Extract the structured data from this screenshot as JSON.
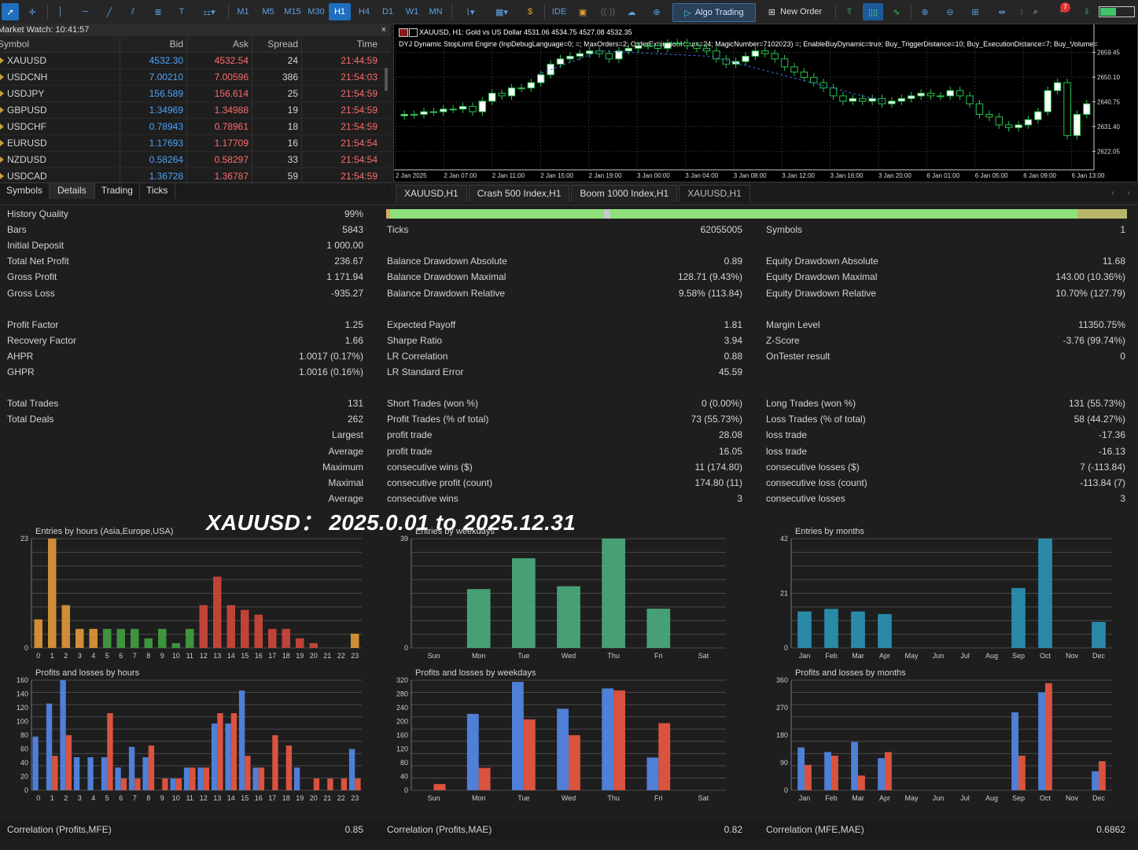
{
  "toolbar": {
    "timeframes": [
      "M1",
      "M5",
      "M15",
      "M30",
      "H1",
      "H4",
      "D1",
      "W1",
      "MN"
    ],
    "active_tf": "H1",
    "ide": "IDE",
    "algo": "Algo Trading",
    "new_order": "New Order",
    "notif_count": "7"
  },
  "market_watch": {
    "title": "Market Watch: 10:41:57",
    "close": "×",
    "headers": {
      "symbol": "Symbol",
      "bid": "Bid",
      "ask": "Ask",
      "spread": "Spread",
      "time": "Time"
    },
    "rows": [
      {
        "symbol": "XAUUSD",
        "bid": "4532.30",
        "ask": "4532.54",
        "spread": "24",
        "time": "21:44:59"
      },
      {
        "symbol": "USDCNH",
        "bid": "7.00210",
        "ask": "7.00596",
        "spread": "386",
        "time": "21:54:03"
      },
      {
        "symbol": "USDJPY",
        "bid": "156.589",
        "ask": "156.614",
        "spread": "25",
        "time": "21:54:59"
      },
      {
        "symbol": "GBPUSD",
        "bid": "1.34969",
        "ask": "1.34988",
        "spread": "19",
        "time": "21:54:59"
      },
      {
        "symbol": "USDCHF",
        "bid": "0.78943",
        "ask": "0.78961",
        "spread": "18",
        "time": "21:54:59"
      },
      {
        "symbol": "EURUSD",
        "bid": "1.17693",
        "ask": "1.17709",
        "spread": "16",
        "time": "21:54:54"
      },
      {
        "symbol": "NZDUSD",
        "bid": "0.58264",
        "ask": "0.58297",
        "spread": "33",
        "time": "21:54:54"
      },
      {
        "symbol": "USDCAD",
        "bid": "1.36728",
        "ask": "1.36787",
        "spread": "59",
        "time": "21:54:59"
      }
    ],
    "tabs": [
      "Symbols",
      "Details",
      "Trading",
      "Ticks"
    ]
  },
  "chart": {
    "info1": "XAUUSD, H1:  Gold vs US Dollar  4531.06  4534.75  4527.08  4532.35",
    "info2": "DYJ Dynamic StopLimit Engine (InpDebugLanguage=0; =; MaxOrders=2; OrderExpirationHours=24; MagicNumber=7102023) =; EnableBuyDynamic=true; Buy_TriggerDistance=10; Buy_ExecutionDistance=7; Buy_Volume=",
    "price_ticks": [
      "2659.45",
      "2650.10",
      "2640.75",
      "2631.40",
      "2622.05"
    ],
    "time_ticks": [
      "2 Jan 2025",
      "2 Jan 07:00",
      "2 Jan 11:00",
      "2 Jan 15:00",
      "2 Jan 19:00",
      "3 Jan 00:00",
      "3 Jan 04:00",
      "3 Jan 08:00",
      "3 Jan 12:00",
      "3 Jan 16:00",
      "3 Jan 20:00",
      "6 Jan 01:00",
      "6 Jan 05:00",
      "6 Jan 09:00",
      "6 Jan 13:00"
    ],
    "tabs": [
      "XAUUSD,H1",
      "Crash 500 Index,H1",
      "Boom 1000 Index,H1",
      "XAUUSD,H1"
    ]
  },
  "stats": {
    "col1": [
      [
        "History Quality",
        "99%"
      ],
      [
        "Bars",
        "5843"
      ],
      [
        "Initial Deposit",
        "1 000.00"
      ],
      [
        "Total Net Profit",
        "236.67"
      ],
      [
        "Gross Profit",
        "1 171.94"
      ],
      [
        "Gross Loss",
        "-935.27"
      ],
      [
        "",
        ""
      ],
      [
        "Profit Factor",
        "1.25"
      ],
      [
        "Recovery Factor",
        "1.66"
      ],
      [
        "AHPR",
        "1.0017 (0.17%)"
      ],
      [
        "GHPR",
        "1.0016 (0.16%)"
      ],
      [
        "",
        ""
      ],
      [
        "Total Trades",
        "131"
      ],
      [
        "Total Deals",
        "262"
      ]
    ],
    "col2": [
      [
        "",
        ""
      ],
      [
        "Ticks",
        "62055005"
      ],
      [
        "",
        ""
      ],
      [
        "Balance Drawdown Absolute",
        "0.89"
      ],
      [
        "Balance Drawdown Maximal",
        "128.71 (9.43%)"
      ],
      [
        "Balance Drawdown Relative",
        "9.58% (113.84)"
      ],
      [
        "",
        ""
      ],
      [
        "Expected Payoff",
        "1.81"
      ],
      [
        "Sharpe Ratio",
        "3.94"
      ],
      [
        "LR Correlation",
        "0.88"
      ],
      [
        "LR Standard Error",
        "45.59"
      ],
      [
        "",
        ""
      ],
      [
        "Short Trades (won %)",
        "0 (0.00%)"
      ],
      [
        "Profit Trades (% of total)",
        "73 (55.73%)"
      ],
      [
        "profit trade",
        "28.08"
      ],
      [
        "profit trade",
        "16.05"
      ],
      [
        "consecutive wins ($)",
        "11 (174.80)"
      ],
      [
        "consecutive profit (count)",
        "174.80 (11)"
      ],
      [
        "consecutive wins",
        "3"
      ]
    ],
    "col3": [
      [
        "",
        ""
      ],
      [
        "Symbols",
        "1"
      ],
      [
        "",
        ""
      ],
      [
        "Equity Drawdown Absolute",
        "11.68"
      ],
      [
        "Equity Drawdown Maximal",
        "143.00 (10.36%)"
      ],
      [
        "Equity Drawdown Relative",
        "10.70% (127.79)"
      ],
      [
        "",
        ""
      ],
      [
        "Margin Level",
        "11350.75%"
      ],
      [
        "Z-Score",
        "-3.76 (99.74%)"
      ],
      [
        "OnTester result",
        "0"
      ],
      [
        "",
        ""
      ],
      [
        "",
        ""
      ],
      [
        "Long Trades (won %)",
        "131 (55.73%)"
      ],
      [
        "Loss Trades (% of total)",
        "58 (44.27%)"
      ],
      [
        "loss trade",
        "-17.36"
      ],
      [
        "loss trade",
        "-16.13"
      ],
      [
        "consecutive losses ($)",
        "7 (-113.84)"
      ],
      [
        "consecutive loss (count)",
        "-113.84 (7)"
      ],
      [
        "consecutive losses",
        "3"
      ]
    ],
    "sublabels": [
      "Largest",
      "Average",
      "Maximum",
      "Maximal",
      "Average"
    ],
    "correlations": [
      [
        "Correlation (Profits,MFE)",
        "0.85"
      ],
      [
        "Correlation (Profits,MAE)",
        "0.82"
      ],
      [
        "Correlation (MFE,MAE)",
        "0.6862"
      ]
    ]
  },
  "overlay": "XAUUSD： 2025.0.01 to 2025.12.31",
  "colors": {
    "asia": "#d9943a",
    "europe": "#3f9b3f",
    "usa": "#c9463a",
    "weekday": "#4aa87a",
    "month": "#2c8fb0",
    "profit": "#4f7fd6",
    "loss": "#d9533f"
  },
  "chart_data": [
    {
      "type": "bar",
      "title": "Entries by hours (Asia,Europe,USA)",
      "categories": [
        "0",
        "1",
        "2",
        "3",
        "4",
        "5",
        "6",
        "7",
        "8",
        "9",
        "10",
        "11",
        "12",
        "13",
        "14",
        "15",
        "16",
        "17",
        "18",
        "19",
        "20",
        "21",
        "22",
        "23"
      ],
      "values": [
        6,
        23,
        9,
        4,
        4,
        4,
        4,
        4,
        2,
        4,
        1,
        4,
        9,
        15,
        9,
        8,
        7,
        4,
        4,
        2,
        1,
        0,
        0,
        3
      ],
      "ylim": [
        0,
        23
      ]
    },
    {
      "type": "bar",
      "title": "Entries by weekdays",
      "categories": [
        "Sun",
        "Mon",
        "Tue",
        "Wed",
        "Thu",
        "Fri",
        "Sat"
      ],
      "values": [
        0,
        21,
        32,
        22,
        39,
        14,
        0
      ],
      "ylim": [
        0,
        39
      ]
    },
    {
      "type": "bar",
      "title": "Entries by months",
      "categories": [
        "Jan",
        "Feb",
        "Mar",
        "Apr",
        "May",
        "Jun",
        "Jul",
        "Aug",
        "Sep",
        "Oct",
        "Nov",
        "Dec"
      ],
      "values": [
        14,
        15,
        14,
        13,
        0,
        0,
        0,
        0,
        23,
        42,
        0,
        10
      ],
      "ylim": [
        0,
        42
      ]
    },
    {
      "type": "bar",
      "title": "Profits and losses by hours",
      "categories": [
        "0",
        "1",
        "2",
        "3",
        "4",
        "5",
        "6",
        "7",
        "8",
        "9",
        "10",
        "11",
        "12",
        "13",
        "14",
        "15",
        "16",
        "17",
        "18",
        "19",
        "20",
        "21",
        "22",
        "23"
      ],
      "series": [
        {
          "values": [
            78,
            126,
            160,
            48,
            48,
            48,
            33,
            63,
            48,
            0,
            17,
            33,
            33,
            97,
            97,
            145,
            33,
            0,
            0,
            33,
            0,
            0,
            0,
            60
          ]
        },
        {
          "values": [
            0,
            50,
            80,
            0,
            0,
            112,
            17,
            17,
            65,
            17,
            17,
            33,
            33,
            112,
            112,
            50,
            33,
            80,
            65,
            0,
            17,
            17,
            17,
            17
          ]
        }
      ],
      "ylim": [
        0,
        160
      ]
    },
    {
      "type": "bar",
      "title": "Profits and losses by weekdays",
      "categories": [
        "Sun",
        "Mon",
        "Tue",
        "Wed",
        "Thu",
        "Fri",
        "Sat"
      ],
      "series": [
        {
          "values": [
            0,
            222,
            315,
            237,
            296,
            95,
            0
          ]
        },
        {
          "values": [
            18,
            65,
            206,
            160,
            290,
            195,
            0
          ]
        }
      ],
      "ylim": [
        0,
        320
      ]
    },
    {
      "type": "bar",
      "title": "Profits and losses by months",
      "categories": [
        "Jan",
        "Feb",
        "Mar",
        "Apr",
        "May",
        "Jun",
        "Jul",
        "Aug",
        "Sep",
        "Oct",
        "Nov",
        "Dec"
      ],
      "series": [
        {
          "values": [
            140,
            125,
            158,
            105,
            0,
            0,
            0,
            0,
            255,
            320,
            0,
            62
          ]
        },
        {
          "values": [
            83,
            113,
            48,
            125,
            0,
            0,
            0,
            0,
            113,
            350,
            0,
            95
          ]
        }
      ],
      "ylim": [
        0,
        360
      ]
    }
  ]
}
